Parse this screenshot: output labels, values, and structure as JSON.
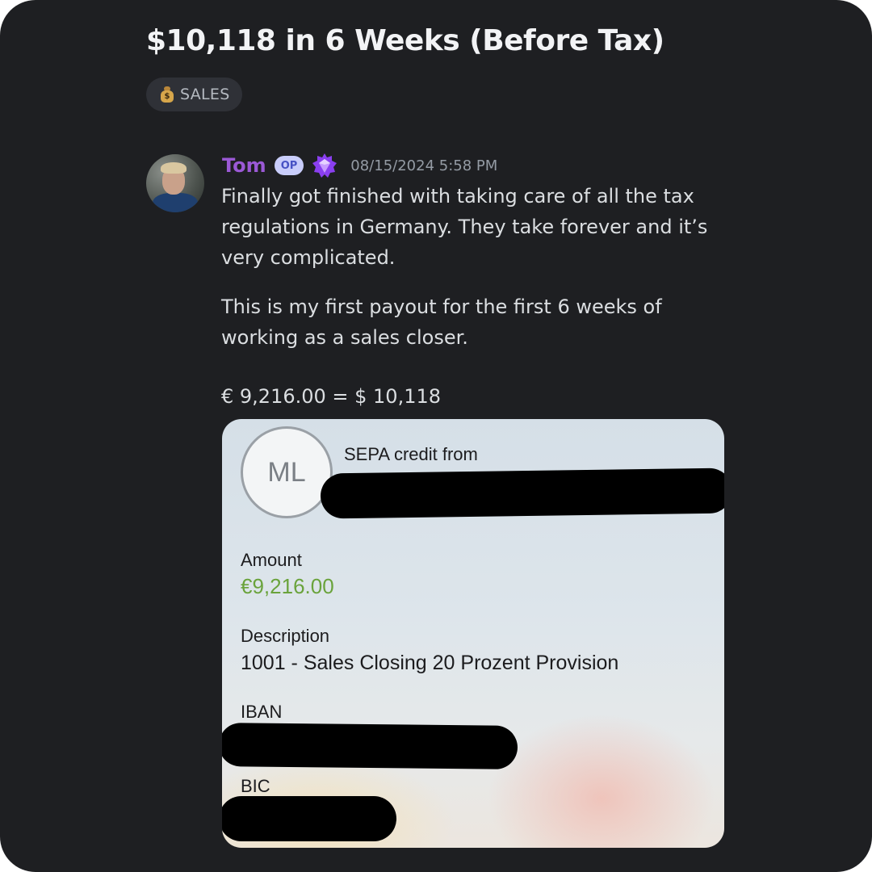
{
  "post": {
    "title": "$10,118 in 6 Weeks (Before Tax)",
    "tag": {
      "label": "SALES",
      "icon": "money-bag-icon"
    }
  },
  "message": {
    "author": "Tom",
    "op_badge": "OP",
    "role_icon": "purple-gem-badge-icon",
    "timestamp": "08/15/2024 5:58 PM",
    "paragraphs": [
      "Finally got finished with taking care of all the tax regulations in Germany. They take forever and it’s very complicated.",
      "This is my first payout for the first 6 weeks of working as a sales closer.",
      "€ 9,216.00 = $ 10,118"
    ]
  },
  "attachment": {
    "initials": "ML",
    "sepa_label": "SEPA credit from",
    "amount_label": "Amount",
    "amount_value": "€9,216.00",
    "description_label": "Description",
    "description_value": "1001 - Sales Closing 20 Prozent Provision",
    "iban_label": "IBAN",
    "bic_label": "BIC"
  },
  "colors": {
    "background": "#1e1f22",
    "author": "#9b59d6",
    "amount": "#6aa33c",
    "op_badge": "#c9cdfb"
  }
}
